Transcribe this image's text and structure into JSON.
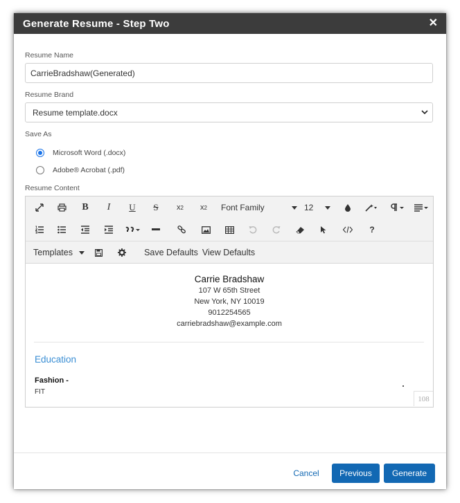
{
  "modal": {
    "title": "Generate Resume - Step Two",
    "close_glyph": "✕"
  },
  "form": {
    "resume_name_label": "Resume Name",
    "resume_name_value": "CarrieBradshaw(Generated)",
    "resume_brand_label": "Resume Brand",
    "resume_brand_value": "Resume template.docx",
    "save_as_label": "Save As",
    "save_as_options": [
      {
        "label": "Microsoft Word (.docx)",
        "selected": true
      },
      {
        "label": "Adobe® Acrobat (.pdf)",
        "selected": false
      }
    ],
    "resume_content_label": "Resume Content"
  },
  "toolbar": {
    "font_family": "Font Family",
    "font_size": "12",
    "templates": "Templates",
    "save_defaults": "Save Defaults",
    "view_defaults": "View Defaults"
  },
  "document": {
    "name": "Carrie Bradshaw",
    "address_line1": "107 W 65th Street",
    "address_line2": "New York, NY 10019",
    "phone": "9012254565",
    "email": "carriebradshaw@example.com",
    "section_title": "Education",
    "entry_title": "Fashion -",
    "entry_detail": "FIT",
    "char_count": "108"
  },
  "footer": {
    "cancel": "Cancel",
    "previous": "Previous",
    "generate": "Generate"
  },
  "colors": {
    "titlebar": "#3c3c3c",
    "primary": "#1268b3",
    "section_heading": "#3a8ed4",
    "radio_selected": "#1a73e8"
  }
}
